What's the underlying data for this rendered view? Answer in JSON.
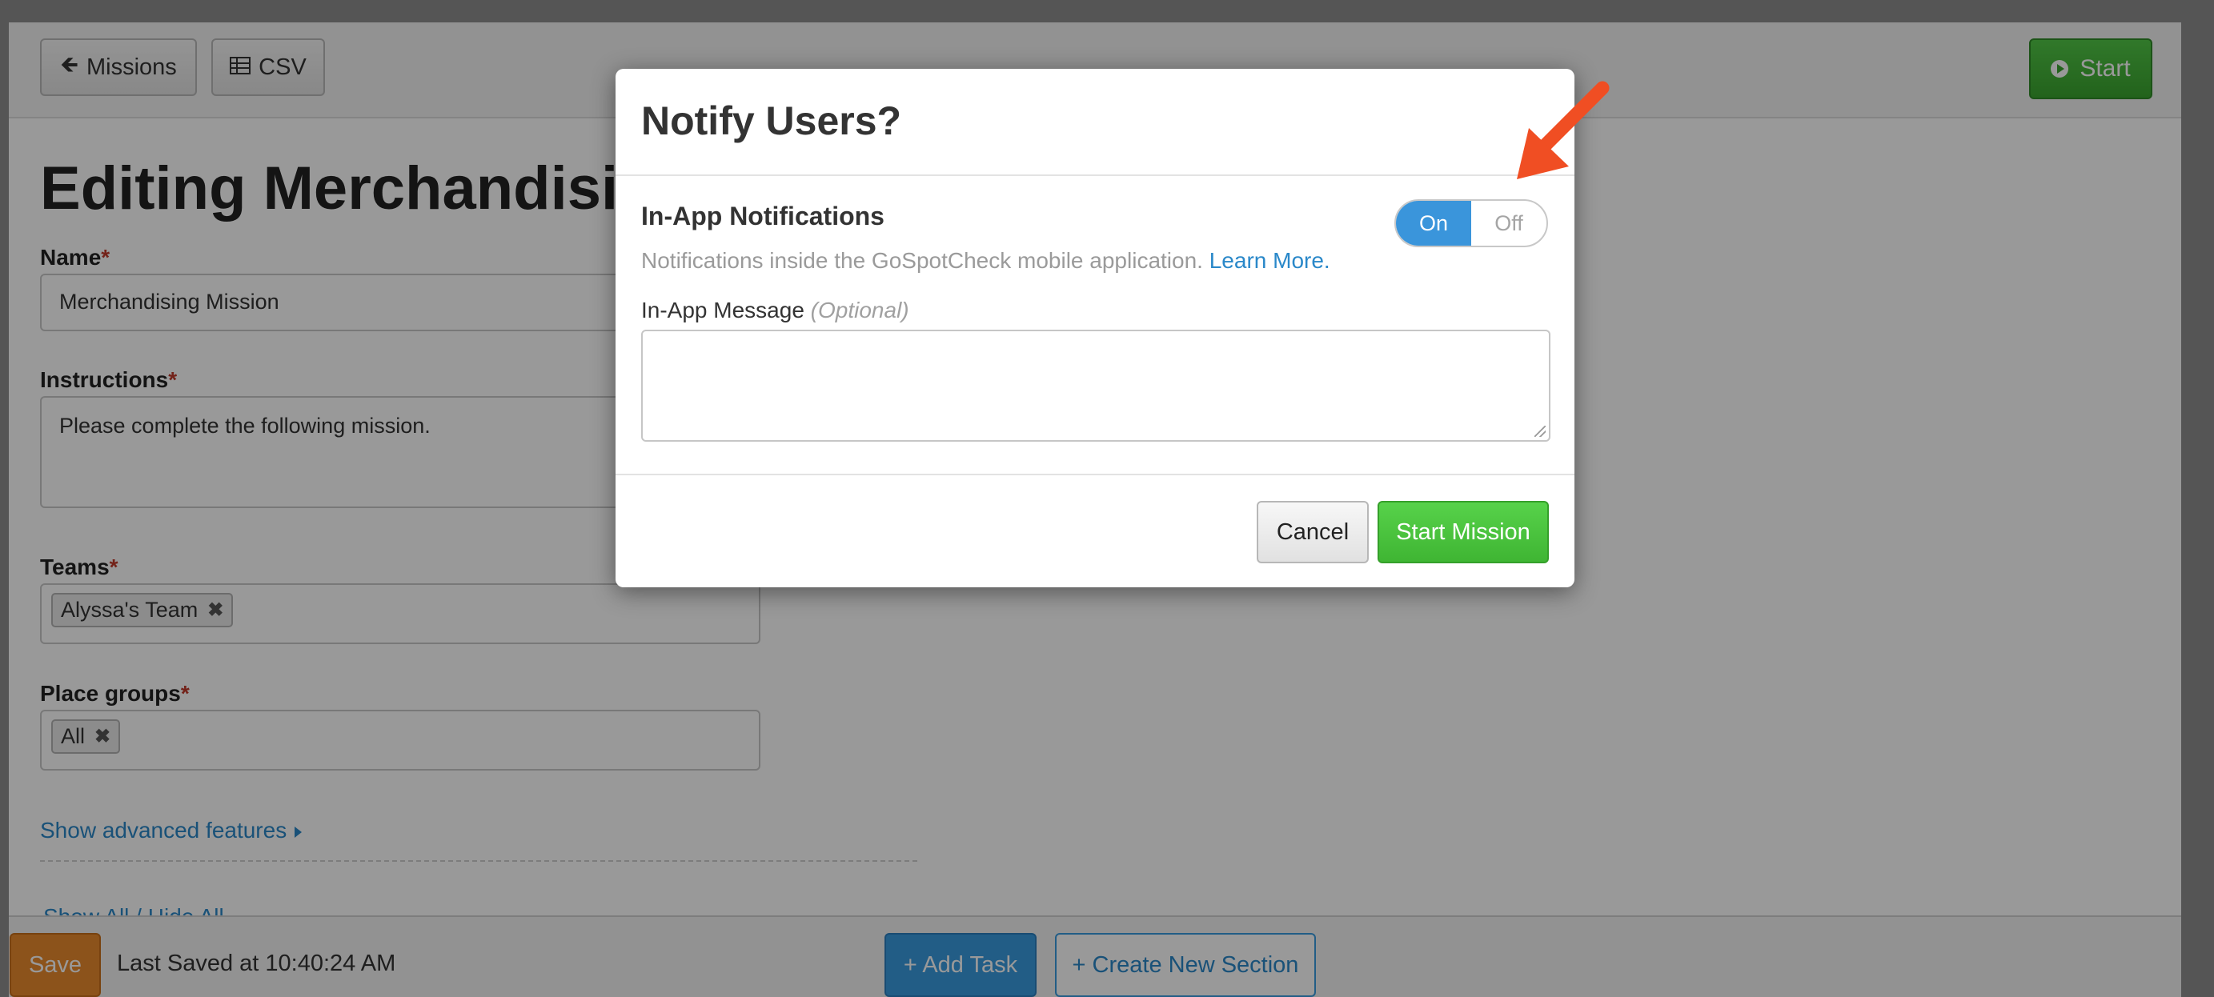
{
  "topbar": {
    "missions_label": "Missions",
    "csv_label": "CSV",
    "start_label": "Start"
  },
  "form": {
    "title": "Editing Merchandisi",
    "name_label": "Name",
    "name_value": "Merchandising Mission",
    "instructions_label": "Instructions",
    "instructions_value": "Please complete the following mission.",
    "teams_label": "Teams",
    "teams": [
      "Alyssa's Team"
    ],
    "place_groups_label": "Place groups",
    "place_groups": [
      "All"
    ],
    "advanced_link": "Show advanced features",
    "show_all": "Show All",
    "hide_all": "Hide All",
    "required_mark": "*",
    "remove_glyph": "✖"
  },
  "bottombar": {
    "save_label": "Save",
    "last_saved": "Last Saved at 10:40:24 AM",
    "add_task_label": "+ Add Task",
    "create_section_label": "+ Create New Section"
  },
  "modal": {
    "title": "Notify Users?",
    "section_title": "In-App Notifications",
    "description": "Notifications inside the GoSpotCheck mobile application.",
    "learn_more": "Learn More.",
    "toggle_on": "On",
    "toggle_off": "Off",
    "toggle_state": "On",
    "message_label": "In-App Message",
    "message_optional": "(Optional)",
    "message_value": "",
    "cancel_label": "Cancel",
    "start_mission_label": "Start Mission"
  },
  "colors": {
    "accent_blue": "#3a95db",
    "start_green": "#3fb533",
    "save_orange": "#ea8a2e",
    "annotation_arrow": "#f04e23"
  }
}
